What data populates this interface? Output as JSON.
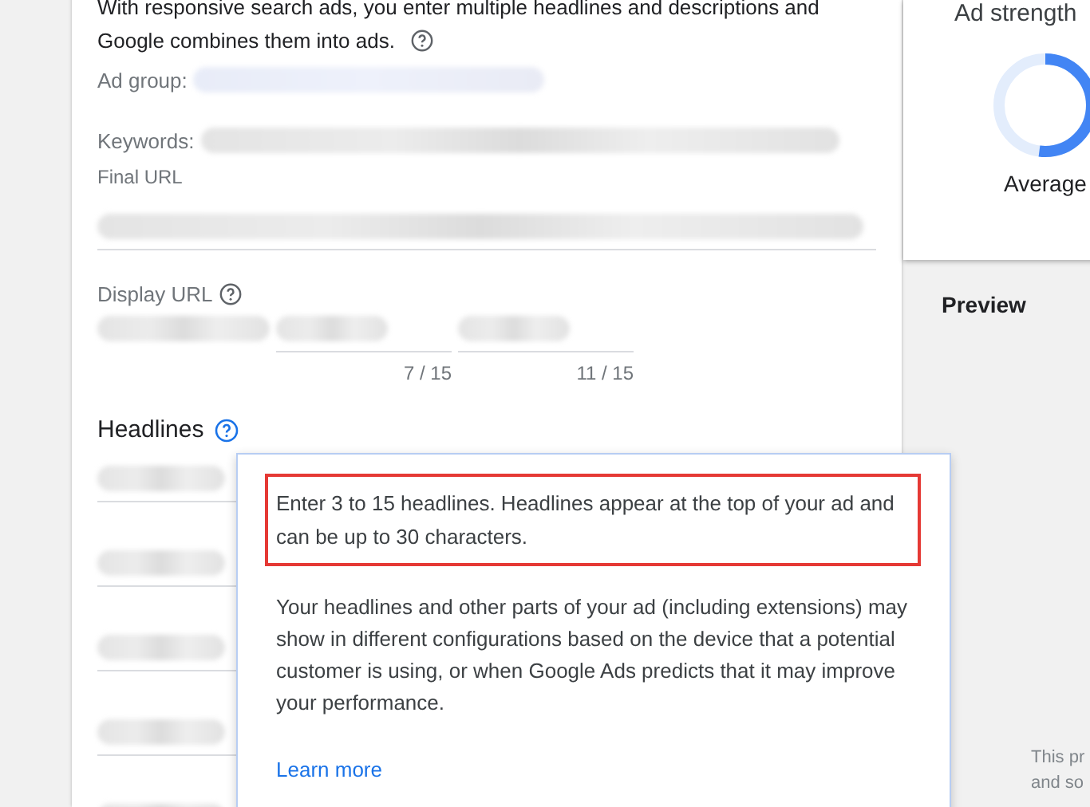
{
  "intro": {
    "text": "With responsive search ads, you enter multiple headlines and descriptions and Google combines them into ads."
  },
  "ad_group": {
    "label": "Ad group:"
  },
  "keywords": {
    "label": "Keywords:"
  },
  "final_url": {
    "label": "Final URL"
  },
  "display_url": {
    "label": "Display URL",
    "path_counters": [
      "7 / 15",
      "11 / 15"
    ]
  },
  "headlines": {
    "label": "Headlines"
  },
  "tooltip": {
    "highlighted_text": "Enter 3 to 15 headlines. Headlines appear at the top of your ad and can be up to 30 characters.",
    "body": "Your headlines and other parts of your ad (including extensions) may show in different configurations based on the device that a potential customer is using, or when Google Ads predicts that it may improve your performance.",
    "link": "Learn more"
  },
  "ad_strength": {
    "title": "Ad strength",
    "level": 0.52,
    "rating": "Average"
  },
  "preview": {
    "title": "Preview",
    "note_lines": [
      "This pr",
      "and so"
    ]
  }
}
